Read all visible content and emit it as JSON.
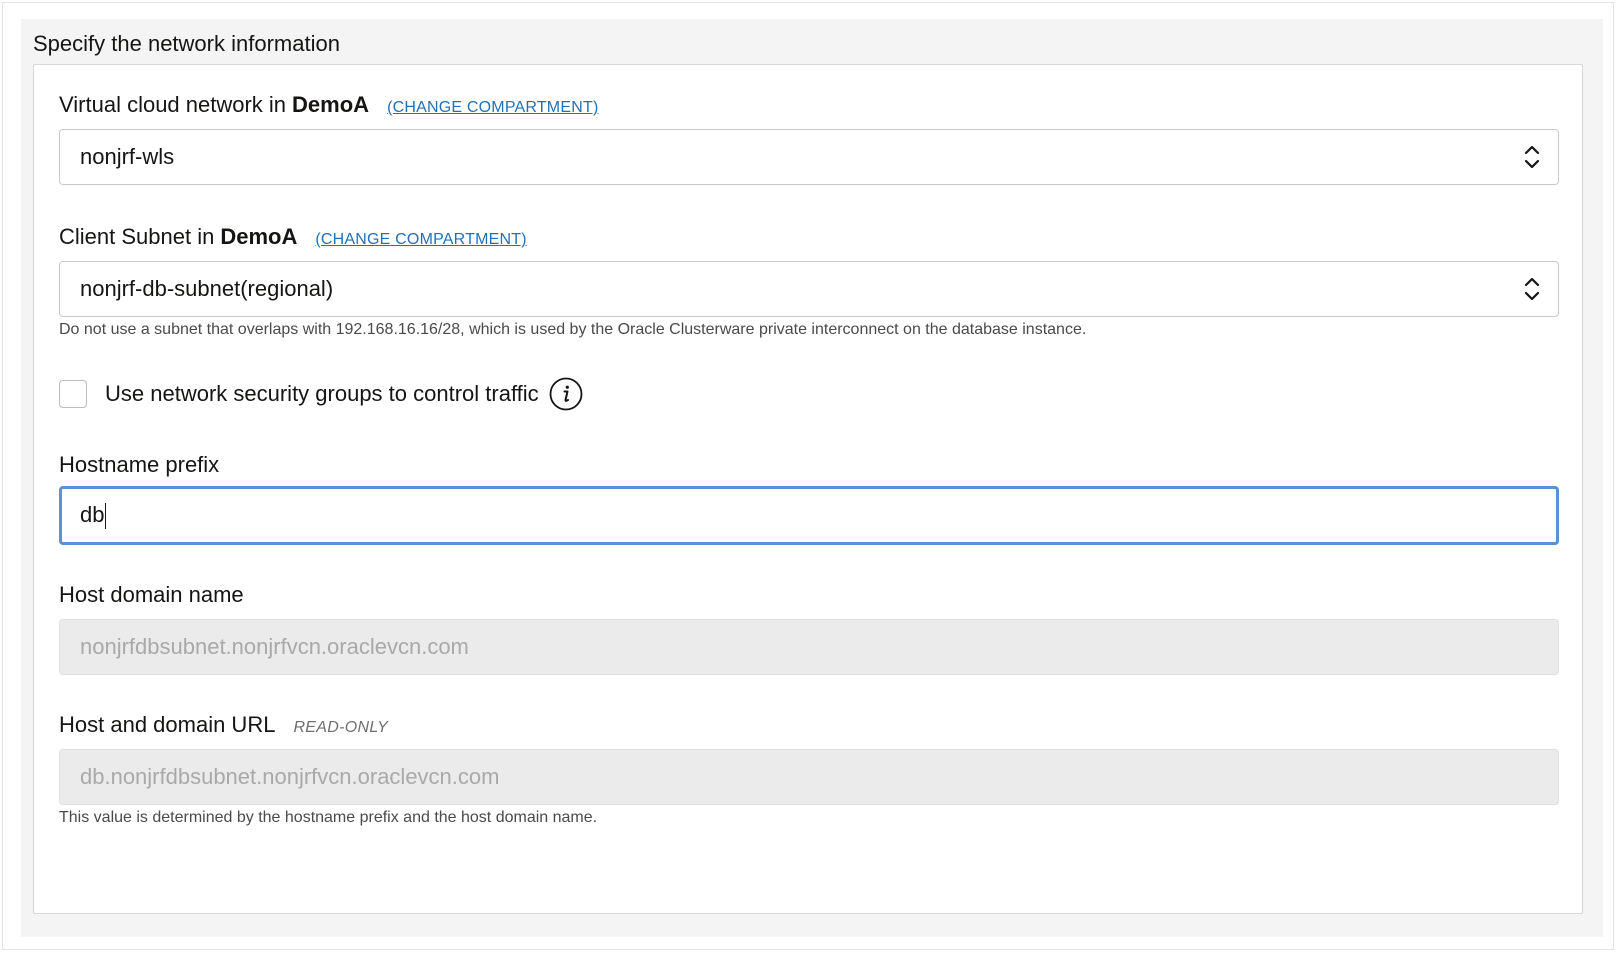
{
  "section": {
    "title": "Specify the network information"
  },
  "vcn": {
    "label": "Virtual cloud network in",
    "compartment": "DemoA",
    "change_link": "(CHANGE COMPARTMENT)",
    "value": "nonjrf-wls"
  },
  "subnet": {
    "label": "Client Subnet in",
    "compartment": "DemoA",
    "change_link": "(CHANGE COMPARTMENT)",
    "value": "nonjrf-db-subnet(regional)",
    "help": "Do not use a subnet that overlaps with 192.168.16.16/28, which is used by the Oracle Clusterware private interconnect on the database instance."
  },
  "nsg": {
    "label": "Use network security groups to control traffic",
    "checked": false
  },
  "hostname_prefix": {
    "label": "Hostname prefix",
    "value": "db"
  },
  "host_domain": {
    "label": "Host domain name",
    "value": "nonjrfdbsubnet.nonjrfvcn.oraclevcn.com"
  },
  "host_url": {
    "label": "Host and domain URL",
    "tag": "READ-ONLY",
    "value": "db.nonjrfdbsubnet.nonjrfvcn.oraclevcn.com",
    "help": "This value is determined by the hostname prefix and the host domain name."
  },
  "colors": {
    "link": "#1f71b8",
    "focus_border": "#5a92d6",
    "disabled_bg": "#ebebeb",
    "disabled_text": "#a9a9a9",
    "section_bg": "#f4f4f4"
  },
  "icons": {
    "select_indicator": "chevron-up-down-icon",
    "info": "info-icon"
  }
}
